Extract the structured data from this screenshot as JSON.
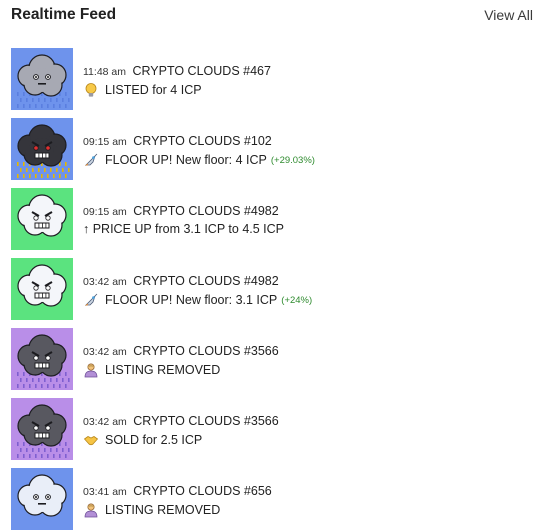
{
  "header": {
    "title": "Realtime Feed",
    "view_all": "View All"
  },
  "feed": [
    {
      "time": "11:48 am",
      "name": "CRYPTO CLOUDS #467",
      "icon": "lightbulb-icon",
      "action": "LISTED for 4 ICP",
      "delta": "",
      "cloud": {
        "bg": "#6e93ec",
        "body": "#a7a9b3",
        "face": "calm",
        "rain": "#5a7fe0"
      }
    },
    {
      "time": "09:15 am",
      "name": "CRYPTO CLOUDS #102",
      "icon": "rocket-icon",
      "action": "FLOOR UP! New floor: 4 ICP",
      "delta": "(+29.03%)",
      "cloud": {
        "bg": "#6e93ec",
        "body": "#35353b",
        "face": "angry-red",
        "rain": "#e6b800"
      }
    },
    {
      "time": "09:15 am",
      "name": "CRYPTO CLOUDS #4982",
      "icon": "arrow-up-icon",
      "action": "↑ PRICE UP from 3.1 ICP to 4.5 ICP",
      "delta": "",
      "cloud": {
        "bg": "#5be37f",
        "body": "#f4f6fa",
        "face": "angry",
        "rain": ""
      }
    },
    {
      "time": "03:42 am",
      "name": "CRYPTO CLOUDS #4982",
      "icon": "rocket-icon",
      "action": "FLOOR UP! New floor: 3.1 ICP",
      "delta": "(+24%)",
      "cloud": {
        "bg": "#5be37f",
        "body": "#f4f6fa",
        "face": "angry",
        "rain": ""
      }
    },
    {
      "time": "03:42 am",
      "name": "CRYPTO CLOUDS #3566",
      "icon": "person-icon",
      "action": "LISTING REMOVED",
      "delta": "",
      "cloud": {
        "bg": "#b98ee8",
        "body": "#585860",
        "face": "angry",
        "rain": "#7f5fd0"
      }
    },
    {
      "time": "03:42 am",
      "name": "CRYPTO CLOUDS #3566",
      "icon": "handshake-icon",
      "action": "SOLD for 2.5 ICP",
      "delta": "",
      "cloud": {
        "bg": "#b98ee8",
        "body": "#585860",
        "face": "angry",
        "rain": "#7f5fd0"
      }
    },
    {
      "time": "03:41 am",
      "name": "CRYPTO CLOUDS #656",
      "icon": "person-icon",
      "action": "LISTING REMOVED",
      "delta": "",
      "cloud": {
        "bg": "#6e93ec",
        "body": "#e9eef8",
        "face": "calm",
        "rain": ""
      }
    }
  ]
}
